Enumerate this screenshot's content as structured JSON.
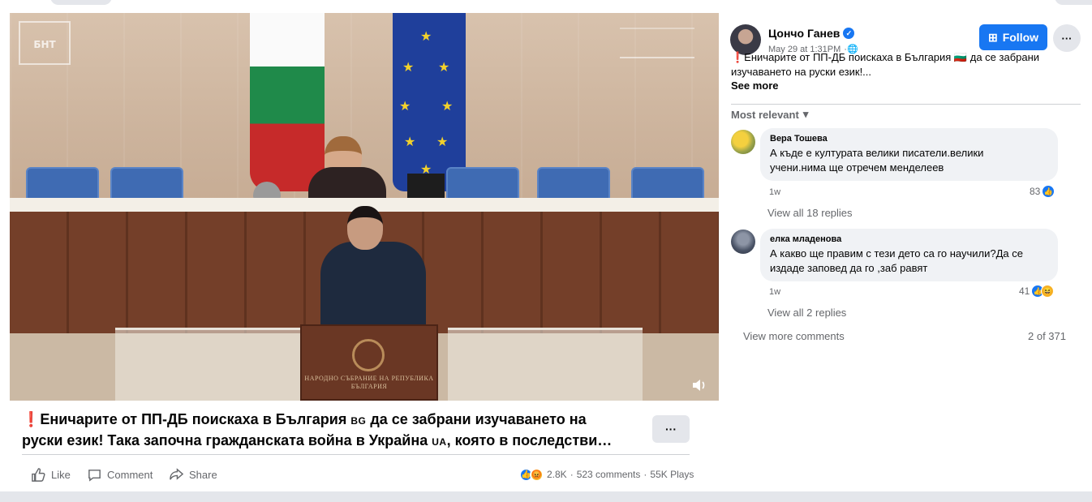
{
  "video": {
    "channel_logo": "БНТ",
    "podium_text": "НАРОДНО СЪБРАНИЕ НА РЕПУБЛИКА БЪЛГАРИЯ"
  },
  "post": {
    "caption_line1": "Еничарите от ПП-ДБ поискаха в България",
    "caption_line1_flag": "BG",
    "caption_line1_end": "да се забрани изучаването на",
    "caption_line2": "руски език! Така започна гражданската война в Украйна",
    "caption_line2_flag": "UA",
    "caption_line2_end": ", която в последстви…",
    "more_label": "···",
    "actions": {
      "like": "Like",
      "comment": "Comment",
      "share": "Share"
    },
    "stats": {
      "reactions": "2.8K",
      "separator": "·",
      "comments": "523 comments",
      "plays": "55K Plays"
    }
  },
  "sidebar": {
    "author": "Цончо Ганев",
    "time": "May 29 at 1:31PM",
    "follow_label": "Follow",
    "more_label": "···",
    "text": "❗Еничарите от ПП-ДБ поискаха в България 🇧🇬 да се забрани изучаването на руски език!...",
    "see_more": "See more",
    "sort_label": "Most relevant",
    "comments": [
      {
        "name": "Вера Тошева",
        "line1": "А къде е културата велики писатели.велики",
        "line2": "учени.нима ще отречем менделеев",
        "time": "1w",
        "reactions": "83",
        "view_replies": "View all 18 replies"
      },
      {
        "name": "елка младенова",
        "line1": "А какво ще правим с тези дето са го научили?Да се",
        "line2": "издаде заповед да го ,заб равят",
        "time": "1w",
        "reactions": "41",
        "view_replies": "View all 2 replies"
      }
    ],
    "view_more_comments": "View more comments",
    "comment_count": "2 of 371"
  },
  "colors": {
    "accent": "#1877f2",
    "secondary_text": "#65676b",
    "bubble": "#f0f2f5"
  }
}
